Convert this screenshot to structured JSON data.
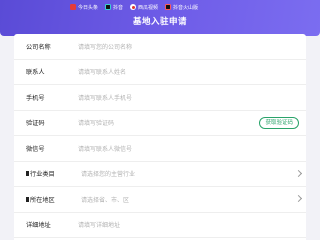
{
  "header": {
    "title": "基地入驻申请",
    "partners": [
      {
        "name": "今日头条",
        "logo": "toutiao-logo"
      },
      {
        "name": "抖音",
        "logo": "douyin-logo"
      },
      {
        "name": "西瓜视频",
        "logo": "xigua-logo"
      },
      {
        "name": "抖音火山版",
        "logo": "huoshan-logo"
      }
    ]
  },
  "form": {
    "fields": [
      {
        "label": "公司名称",
        "placeholder": "请填写您的公司名称"
      },
      {
        "label": "联系人",
        "placeholder": "请填写联系人姓名"
      },
      {
        "label": "手机号",
        "placeholder": "请填写联系人手机号"
      },
      {
        "label": "验证码",
        "placeholder": "请填写验证码",
        "button": "获取验证码"
      },
      {
        "label": "微信号",
        "placeholder": "请填写联系人微信号"
      },
      {
        "label": "行业类目",
        "placeholder": "请选择您的主营行业"
      },
      {
        "label": "所在地区",
        "placeholder": "请选择省、市、区"
      },
      {
        "label": "详细地址",
        "placeholder": "请填写详细地址"
      }
    ]
  }
}
